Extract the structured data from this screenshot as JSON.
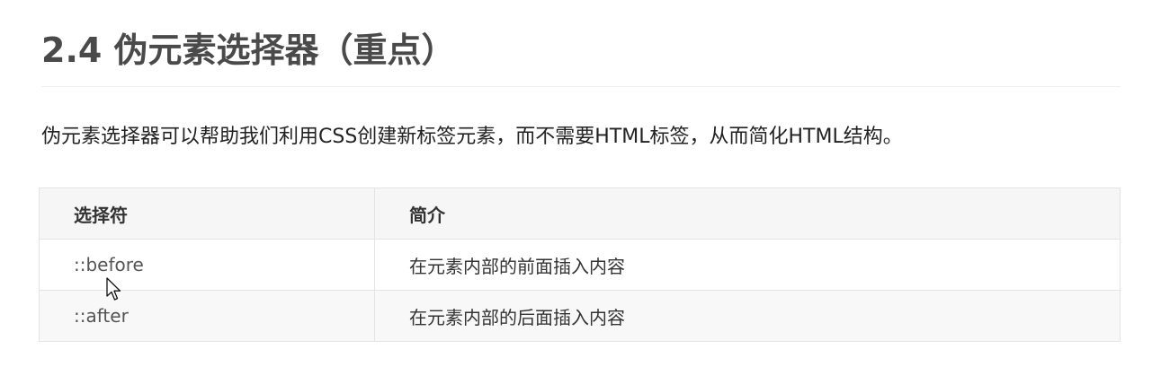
{
  "heading": "2.4 伪元素选择器（重点）",
  "intro": "伪元素选择器可以帮助我们利用CSS创建新标签元素，而不需要HTML标签，从而简化HTML结构。",
  "table": {
    "headers": [
      "选择符",
      "简介"
    ],
    "rows": [
      {
        "selector": "::before",
        "desc": "在元素内部的前面插入内容"
      },
      {
        "selector": "::after",
        "desc": "在元素内部的后面插入内容"
      }
    ]
  },
  "cursor": {
    "icon": "mouse-pointer-icon"
  },
  "colors": {
    "heading": "#4a4a4a",
    "text": "#222222",
    "border": "#e4e4e4",
    "header_bg": "#f6f6f6",
    "alt_row_bg": "#f8f8f8"
  }
}
